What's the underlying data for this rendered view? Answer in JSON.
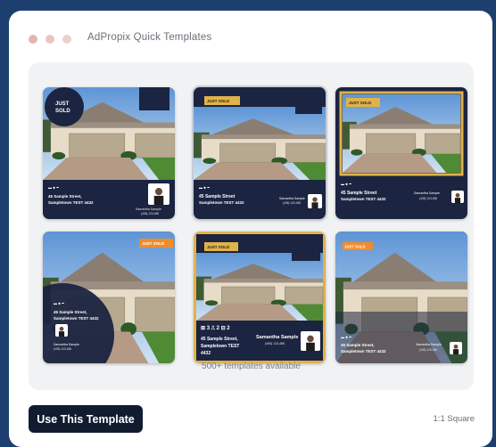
{
  "window": {
    "title": "AdPropix Quick Templates"
  },
  "templates": [
    {
      "badge": "JUST SOLD",
      "address1": "45 Sample Street,",
      "address2": "Sampletown TEST 4432",
      "agent": "Samantha Sample",
      "phone": "(405) 123-456"
    },
    {
      "badge": "JUST SOLD",
      "address1": "45 Sample Street",
      "address2": "Sampletown TEST 4432",
      "agent": "Samantha Sample",
      "phone": "(405) 123-456"
    },
    {
      "badge": "JUST SOLD",
      "address1": "45 Sample Street",
      "address2": "Sampletown TEST 4432",
      "agent": "Samantha Sample",
      "phone": "(405) 123-456"
    },
    {
      "badge": "JUST SOLD",
      "address1": "45 Sample Street,",
      "address2": "Sampletown TEST 4432",
      "agent": "Samantha Sample",
      "phone": "(405) 123-456"
    },
    {
      "badge": "JUST SOLD",
      "address1": "45 Sample Street,",
      "address2": "Samplelown TEST",
      "address3": "4432",
      "agent": "Samantha Sample",
      "phone": "(405) 123-456",
      "beds": "3",
      "baths": "2",
      "cars": "2"
    },
    {
      "badge": "JUST SOLD",
      "address1": "45 Sample Street,",
      "address2": "Sampletown TEST 4432",
      "agent": "Samantha Sample",
      "phone": "(405) 123-456"
    }
  ],
  "count_text": "500+ templates available",
  "cta": {
    "label": "Use This Template"
  },
  "aspect": {
    "label": "1:1 Square"
  },
  "colors": {
    "navy": "#1b2440",
    "gold": "#e0b24a",
    "orange": "#f28c28",
    "button": "#111c30"
  }
}
